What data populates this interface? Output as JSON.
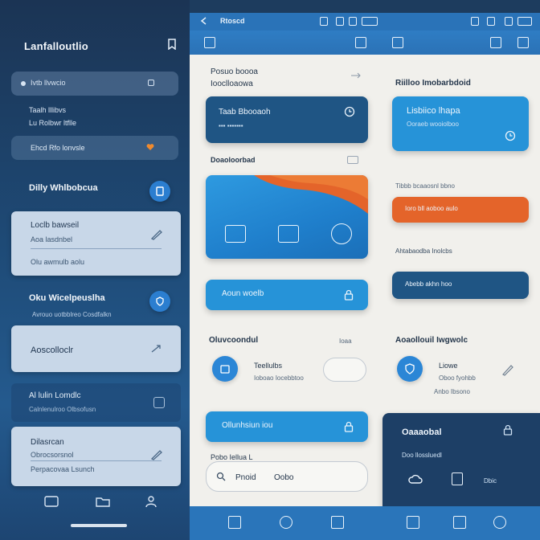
{
  "left_panel": {
    "app_title": "Lanfalloutlio",
    "search_placeholder": "Ivtb llvwcio",
    "stack_lines": [
      "Taalh lllibvs",
      "Lu Rolbwr ltflle"
    ],
    "plain_row_label": "Ehcd Rfo lonvsle",
    "section1_title": "Dilly Whlbobcua",
    "section2_title": "Oku Wicelpeuslha",
    "section2_sub": "Avrouo uotbblreo Cosdfalkn",
    "card1": {
      "title": "Loclb bawseil",
      "line1": "Aoa lasdnbel",
      "line2": "Olu awmulb aolu"
    },
    "card2": {
      "title": "Aoscolloclr"
    },
    "dark_card": {
      "title": "Al lulin Lomdlc",
      "sub": "Calnlenulroo Olbsofusn"
    },
    "card3": {
      "title": "Dilasrcan",
      "line1": "Obrocsorsnol",
      "line2": "Perpacovaa Lsunch"
    }
  },
  "top_bar": {
    "title": "Rtoscd"
  },
  "main": {
    "header_lines": [
      "Posuo boooa",
      "Iooclloaowa"
    ],
    "right_header": "Riilloo Imobarbdoid",
    "card_a_label": "Taab Bbooaoh",
    "card_b_lines": [
      "Lisbiico lhapa",
      "Ooraeb wooiolboo"
    ],
    "label_c": "Doaoloorbad",
    "label_d": "Tibbb bcaaosnl bbno",
    "orange_text": "Ioro bll aoboo aulo",
    "label_e": "Ahtabaodba Inolcbs",
    "card_f_label": "Aoun woelb",
    "card_g_label": "Abebb akhn hoo",
    "section_left": "Oluvcoondul",
    "section_left_right": "Ioaa",
    "section_right": "Aoaollouil Iwgwolc",
    "toggle_left": {
      "title": "Teellulbs",
      "sub": "Ioboao Iocebbtoo"
    },
    "toggle_right": {
      "title": "Liowe",
      "sub": "Oboo fyohbb"
    },
    "toggle_right_extra": "Anbo Ibsono",
    "card_h_label": "Ollunhsiun iou",
    "search_row_label": "Pobo Iellua L",
    "search_row_a": "Pnoid",
    "search_row_b": "Oobo",
    "dark_panel": {
      "title": "Oaaaobal",
      "sub": "Doo llossluedl",
      "i1": "Dbic"
    }
  },
  "colors": {
    "accent": "#2693d8",
    "dark_blue": "#1f5584",
    "orange": "#e4642a",
    "background": "#f1f0ec"
  }
}
